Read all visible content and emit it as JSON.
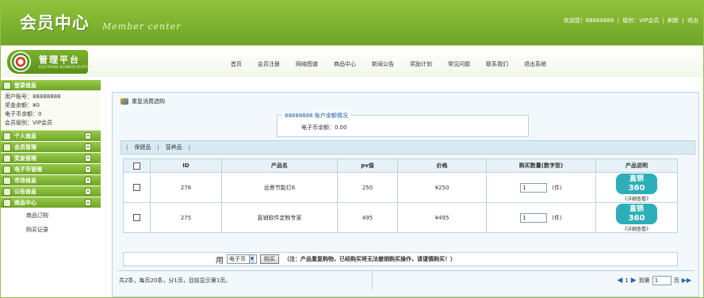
{
  "header": {
    "title": "会员中心",
    "script_text": "Member center",
    "user_info": [
      "欢迎您！88888888",
      "级别：VIP会员",
      "刷新",
      "退出"
    ],
    "user_sep": "|"
  },
  "badge": {
    "text": "管理平台",
    "subtext": "ELECTRONIC BUSINESS PLATFORM"
  },
  "nav": [
    "首页",
    "会员注册",
    "网络图谱",
    "商品中心",
    "新闻公告",
    "奖励计划",
    "常见问题",
    "联系我们",
    "退出系统"
  ],
  "sidebar": {
    "account_header": "登录信息",
    "account_lines": [
      "用户账号：88888888",
      "奖金余额：¥0",
      "电子币余额：0",
      "会员级别：VIP会员"
    ],
    "sections": [
      "个人信息",
      "会员管理",
      "奖金管理",
      "电子币管理",
      "市场信息",
      "公告信息",
      "商品中心"
    ],
    "sub_links": [
      "商品订购",
      "购买记录"
    ]
  },
  "main": {
    "title": "重复消费选购",
    "balance_legend": "88888888 账户余额情况",
    "balance_line": "电子币余额：0.00",
    "tabs": [
      "保健品",
      "营养品"
    ],
    "tab_sep": "|",
    "columns": [
      "",
      "ID",
      "产品名",
      "pv值",
      "价格",
      "购买数量(数字型)",
      "产品说明"
    ],
    "rows": [
      {
        "id": "276",
        "name": "远景节能灯6",
        "pv": "250",
        "price": "¥250",
        "qty": "1",
        "unit": "(件)",
        "logo_l1": "直销",
        "logo_l2": "360",
        "detail": "《详细查看》"
      },
      {
        "id": "275",
        "name": "直销软件定制专家",
        "pv": "495",
        "price": "¥495",
        "qty": "1",
        "unit": "(件)",
        "logo_l1": "直销",
        "logo_l2": "360",
        "detail": "《详细查看》"
      }
    ],
    "buy": {
      "use_label": "用",
      "pay_option": "电子币",
      "button": "购买",
      "note": "（注：产品重复购物，已经购买将无法撤销购买操作，请谨慎购买！）"
    },
    "pager": {
      "summary": "共2条，每页20条，分1页，目前显示第1页。",
      "current": "1",
      "goto_label": "到第",
      "goto_value": "1",
      "goto_unit": "页"
    }
  }
}
